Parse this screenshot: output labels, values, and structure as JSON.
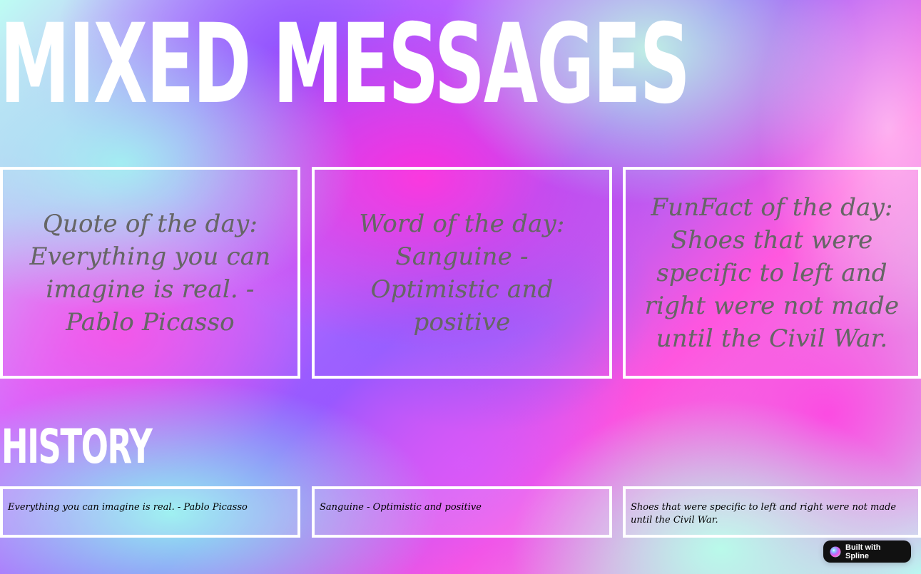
{
  "header": {
    "title": "MIXED MESSAGES"
  },
  "cards": [
    {
      "label": "Quote of the day:",
      "text": "Everything you can imagine is real. - Pablo Picasso"
    },
    {
      "label": "Word of the day:",
      "text": "Sanguine - Optimistic and positive"
    },
    {
      "label": "FunFact of the day:",
      "text": "Shoes that were specific to left and right were not made until the Civil War."
    }
  ],
  "history": {
    "title": "HISTORY",
    "items": [
      "Everything you can imagine is real. - Pablo Picasso",
      "Sanguine - Optimistic and positive",
      "Shoes that were specific to left and right were not made until the Civil War."
    ]
  },
  "badge": {
    "label": "Built with Spline",
    "icon": "spline-logo-icon"
  },
  "colors": {
    "card_text": "#666666",
    "history_text": "#000000",
    "border": "#ffffff",
    "badge_bg": "#111111"
  }
}
